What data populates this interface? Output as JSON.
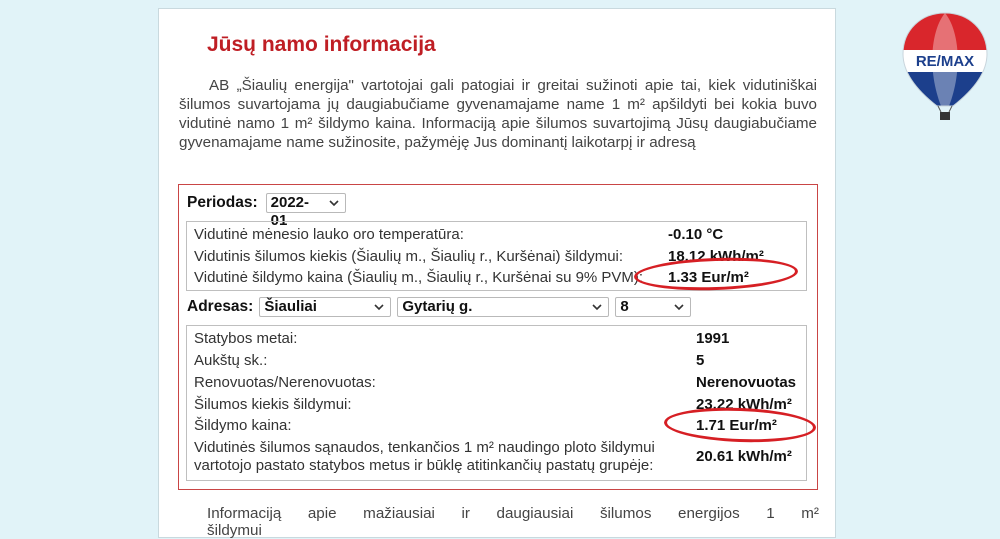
{
  "page": {
    "title": "Jūsų namo informacija",
    "intro": "AB „Šiaulių energija\" vartotojai gali patogiai ir greitai sužinoti apie tai, kiek vidutiniškai šilumos suvartojama jų daugiabučiame gyvenamajame name 1 m² apšildyti bei kokia buvo vidutinė namo 1 m² šildymo kaina. Informaciją apie šilumos suvartojimą Jūsų daugiabučiame gyvenamajame name sužinosite, pažymėję Jus dominantį laikotarpį ir adresą",
    "trailing": "Informaciją apie mažiausiai ir daugiausiai šilumos energijos 1 m² šildymui"
  },
  "period": {
    "label": "Periodas:",
    "selected": "2022-01"
  },
  "city_stats": [
    {
      "label": "Vidutinė mėnesio lauko oro temperatūra:",
      "value": "-0.10 °C"
    },
    {
      "label": "Vidutinis šilumos kiekis (Šiaulių m., Šiaulių r., Kuršėnai) šildymui:",
      "value": "18.12 kWh/m²"
    },
    {
      "label": "Vidutinė šildymo kaina (Šiaulių m., Šiaulių r., Kuršėnai su 9% PVM):",
      "value": "1.33 Eur/m²"
    }
  ],
  "address": {
    "label": "Adresas:",
    "city": "Šiauliai",
    "street": "Gytarių g.",
    "number": "8"
  },
  "house_stats": [
    {
      "label": "Statybos metai:",
      "value": "1991"
    },
    {
      "label": "Aukštų sk.:",
      "value": "5"
    },
    {
      "label": "Renovuotas/Nerenovuotas:",
      "value": "Nerenovuotas"
    },
    {
      "label": "Šilumos kiekis šildymui:",
      "value": "23.22 kWh/m²"
    },
    {
      "label": "Šildymo kaina:",
      "value": "1.71 Eur/m²"
    },
    {
      "label": "Vidutinės šilumos sąnaudos, tenkančios 1 m² naudingo ploto šildymui",
      "label2": "vartotojo pastato statybos metus ir būklę atitinkančių pastatų grupėje:",
      "value": "20.61 kWh/m²"
    }
  ],
  "logo": {
    "text": "RE/MAX"
  },
  "colors": {
    "title": "#bf1e24",
    "highlight": "#d61f24",
    "background": "#e1f3f8"
  }
}
